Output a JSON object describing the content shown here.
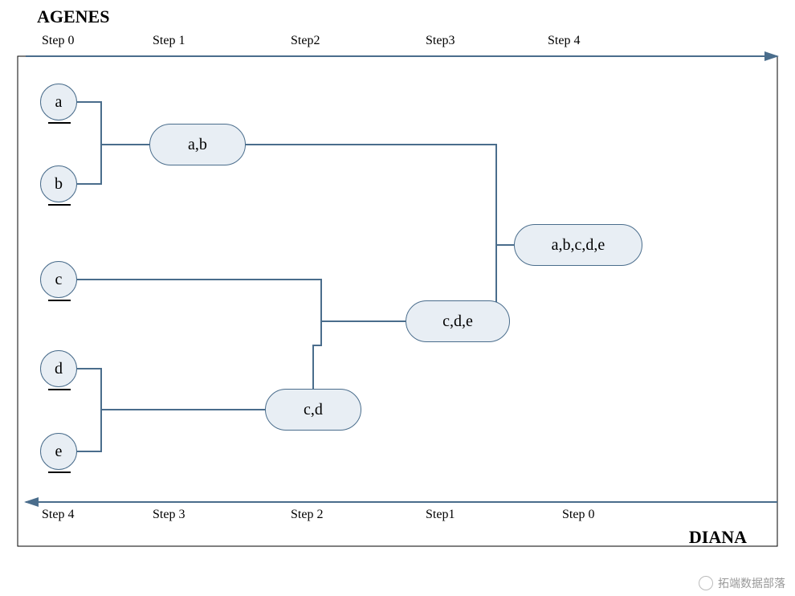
{
  "titles": {
    "top": "AGENES",
    "bottom": "DIANA"
  },
  "steps_top": [
    "Step 0",
    "Step 1",
    "Step2",
    "Step3",
    "Step 4"
  ],
  "steps_bottom": [
    "Step 4",
    "Step 3",
    "Step 2",
    "Step1",
    "Step 0"
  ],
  "nodes": {
    "a": "a",
    "b": "b",
    "c": "c",
    "d": "d",
    "e": "e",
    "ab": "a,b",
    "cd": "c,d",
    "cde": "c,d,e",
    "abcde": "a,b,c,d,e"
  },
  "watermark": "拓端数据部落",
  "chart_data": {
    "type": "diagram",
    "description": "Agglomerative (AGNES, left→right) vs Divisive (DIANA, right→left) hierarchical clustering on points a–e",
    "agnes_steps": [
      {
        "step": 0,
        "clusters": [
          [
            "a"
          ],
          [
            "b"
          ],
          [
            "c"
          ],
          [
            "d"
          ],
          [
            "e"
          ]
        ]
      },
      {
        "step": 1,
        "clusters": [
          [
            "a",
            "b"
          ],
          [
            "c"
          ],
          [
            "d"
          ],
          [
            "e"
          ]
        ]
      },
      {
        "step": 2,
        "clusters": [
          [
            "a",
            "b"
          ],
          [
            "c",
            "d"
          ],
          [
            "e"
          ]
        ]
      },
      {
        "step": 3,
        "clusters": [
          [
            "a",
            "b"
          ],
          [
            "c",
            "d",
            "e"
          ]
        ]
      },
      {
        "step": 4,
        "clusters": [
          [
            "a",
            "b",
            "c",
            "d",
            "e"
          ]
        ]
      }
    ],
    "diana_steps": [
      {
        "step": 0,
        "clusters": [
          [
            "a",
            "b",
            "c",
            "d",
            "e"
          ]
        ]
      },
      {
        "step": 1,
        "clusters": [
          [
            "a",
            "b"
          ],
          [
            "c",
            "d",
            "e"
          ]
        ]
      },
      {
        "step": 2,
        "clusters": [
          [
            "a",
            "b"
          ],
          [
            "c",
            "d"
          ],
          [
            "e"
          ]
        ]
      },
      {
        "step": 3,
        "clusters": [
          [
            "a",
            "b"
          ],
          [
            "c"
          ],
          [
            "d"
          ],
          [
            "e"
          ]
        ]
      },
      {
        "step": 4,
        "clusters": [
          [
            "a"
          ],
          [
            "b"
          ],
          [
            "c"
          ],
          [
            "d"
          ],
          [
            "e"
          ]
        ]
      }
    ],
    "merges_agnes": [
      {
        "from": [
          "a",
          "b"
        ],
        "to": "a,b"
      },
      {
        "from": [
          "c",
          "d"
        ],
        "to": "c,d"
      },
      {
        "from": [
          "c,d",
          "e"
        ],
        "to": "c,d,e"
      },
      {
        "from": [
          "a,b",
          "c,d,e"
        ],
        "to": "a,b,c,d,e"
      }
    ]
  }
}
